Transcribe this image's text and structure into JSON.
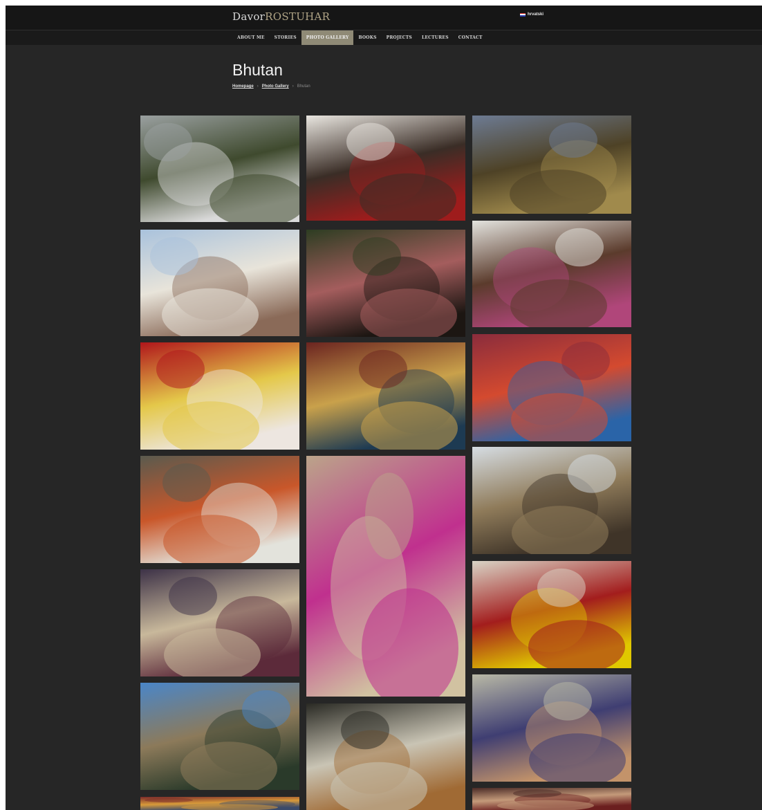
{
  "header": {
    "logo_first": "Davor",
    "logo_last": "ROSTUHAR",
    "language_label": "hrvatski"
  },
  "nav": {
    "items": [
      {
        "label": "About me"
      },
      {
        "label": "Stories"
      },
      {
        "label": "Photo gallery",
        "active": true
      },
      {
        "label": "Books"
      },
      {
        "label": "Projects"
      },
      {
        "label": "Lectures"
      },
      {
        "label": "Contact"
      }
    ]
  },
  "page": {
    "title": "Bhutan"
  },
  "breadcrumb": {
    "home": "Homepage",
    "gallery": "Photo Gallery",
    "current": "Bhutan"
  },
  "colors": {
    "background": "#262626",
    "topbar": "#161616",
    "nav_active": "#8f8a76",
    "logo_accent": "#b0a486"
  },
  "gallery": {
    "photos": [
      {
        "subject": "monastery-on-cliff",
        "tone": [
          "#9aa0a0",
          "#3f4a2e",
          "#d9d9d9"
        ]
      },
      {
        "subject": "monk-in-doorway",
        "tone": [
          "#e9e6e0",
          "#3a2d26",
          "#9e1c1c"
        ]
      },
      {
        "subject": "mountain-valley",
        "tone": [
          "#6d7b93",
          "#4e4226",
          "#a08a4c"
        ]
      },
      {
        "subject": "dzong-festival-crowd",
        "tone": [
          "#a9c2dc",
          "#e8e4da",
          "#8a6a58"
        ]
      },
      {
        "subject": "silhouettes-festival",
        "tone": [
          "#2d3d22",
          "#a45d5d",
          "#1c1612"
        ]
      },
      {
        "subject": "women-at-house",
        "tone": [
          "#e3e3de",
          "#5b3b2c",
          "#b0467a"
        ]
      },
      {
        "subject": "masked-dancers",
        "tone": [
          "#b0161b",
          "#e4c84a",
          "#ede6e0"
        ]
      },
      {
        "subject": "golden-crown-dancer",
        "tone": [
          "#6b2420",
          "#c9a14b",
          "#1d3a52"
        ]
      },
      {
        "subject": "spinning-dancer",
        "tone": [
          "#8a2c3c",
          "#d44a2f",
          "#2a64a8"
        ]
      },
      {
        "subject": "kitchen-fire",
        "tone": [
          "#5a5a4e",
          "#c9572a",
          "#e3e3dc"
        ]
      },
      {
        "subject": "smiling-woman",
        "tone": [
          "#bba48a",
          "#c0308e",
          "#d1c2a1"
        ]
      },
      {
        "subject": "yak-herder-plain",
        "tone": [
          "#d6dde3",
          "#8f7b5a",
          "#3f3428"
        ]
      },
      {
        "subject": "students-classroom",
        "tone": [
          "#3d3247",
          "#c8b89b",
          "#5c2a3a"
        ]
      },
      {
        "subject": "novice-monk-reading",
        "tone": [
          "#d9d4c6",
          "#a31d1d",
          "#e0c800"
        ]
      },
      {
        "subject": "archers-mountains",
        "tone": [
          "#4a86c8",
          "#8c7a5a",
          "#2a3a2a"
        ]
      },
      {
        "subject": "painted-facade",
        "tone": [
          "#2a2a24",
          "#c9c4b4",
          "#a06a34"
        ]
      },
      {
        "subject": "archer-drawing-bow",
        "tone": [
          "#b9b9a6",
          "#3f3e72",
          "#c3936a"
        ]
      },
      {
        "subject": "bottom-left-partial",
        "tone": [
          "#7a2a2a",
          "#d89a3a",
          "#3a4a6a"
        ]
      },
      {
        "subject": "children-portraits",
        "tone": [
          "#4a2a26",
          "#c49a7a",
          "#6b1f1f"
        ]
      }
    ]
  }
}
